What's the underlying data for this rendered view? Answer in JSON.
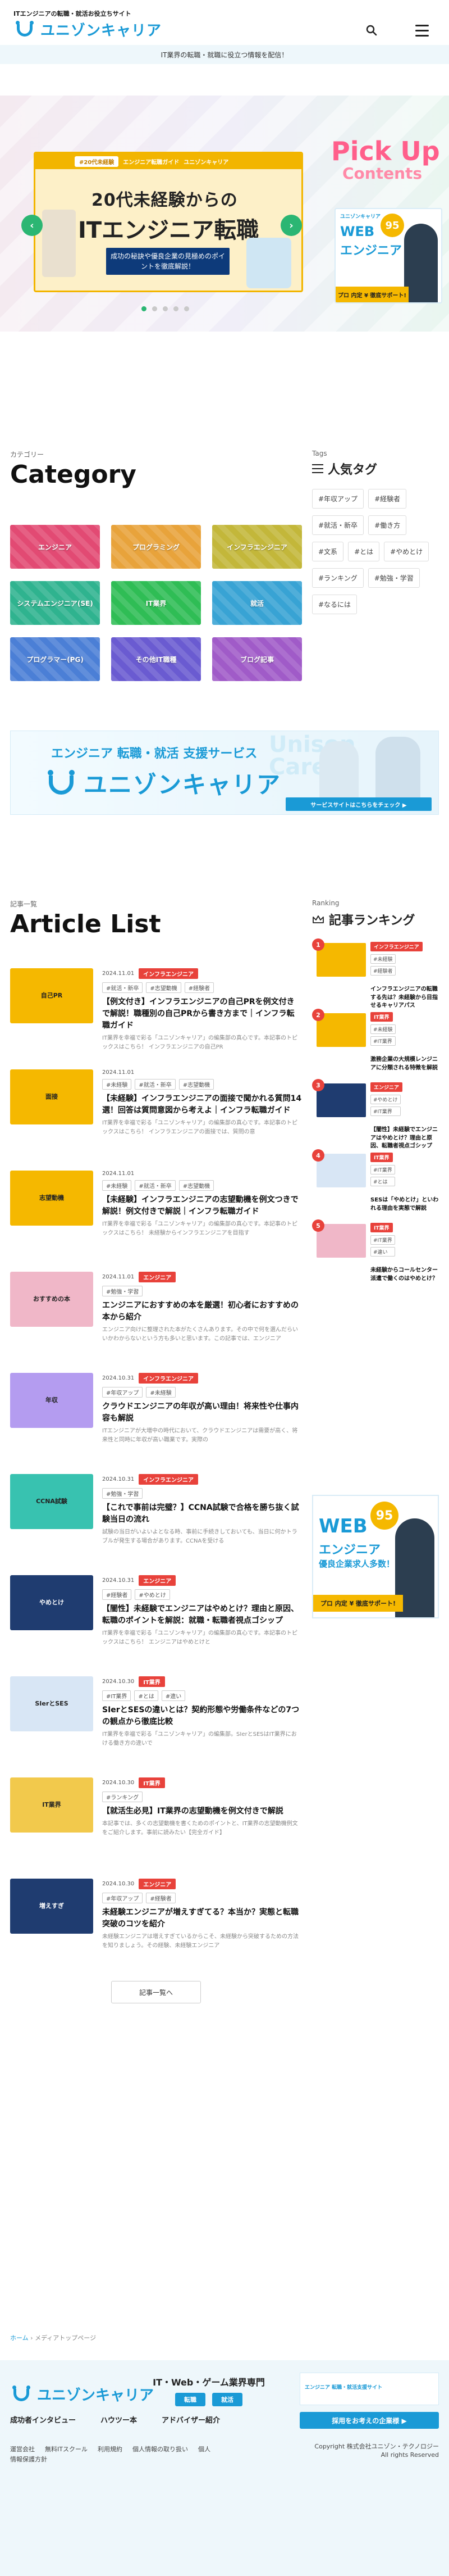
{
  "header": {
    "tagline": "ITエンジニアの転職・就活お役立ちサイト",
    "logo_text": "ユニゾンキャリア",
    "sub_message": "IT業界の転職・就職に役立つ情報を配信！"
  },
  "hero": {
    "slide": {
      "pill": "#20代未経験",
      "pill2": "エンジニア転職ガイド",
      "brand": "ユニゾンキャリア",
      "title1": "20代未経験からの",
      "title2": "ITエンジニア転職",
      "sub": "成功の秘訣や優良企業の見極めのポイントを徹底解説！"
    },
    "prev": "‹",
    "next": "›",
    "pickup_title": "Pick Up",
    "pickup_sub": "Contents",
    "ad": {
      "brand": "ユニゾンキャリア",
      "line1": "WEB",
      "line2": "エンジニア",
      "badge": "95",
      "footer": "プロ 内定 ¥ 徹底サポート!"
    }
  },
  "category": {
    "label": "カテゴリー",
    "title": "Category",
    "items": [
      {
        "label": "エンジニア",
        "color": "#e24a73"
      },
      {
        "label": "プログラミング",
        "color": "#e8a33b"
      },
      {
        "label": "インフラエンジニア",
        "color": "#c3b73a"
      },
      {
        "label": "システムエンジニア(SE)",
        "color": "#2fb38f"
      },
      {
        "label": "IT業界",
        "color": "#2fbd55"
      },
      {
        "label": "就活",
        "color": "#38a3d4"
      },
      {
        "label": "プログラマー(PG)",
        "color": "#4b7fd6"
      },
      {
        "label": "その他IT職種",
        "color": "#6a5bd1"
      },
      {
        "label": "ブログ記事",
        "color": "#a05bc8"
      }
    ]
  },
  "tags": {
    "label": "Tags",
    "title": "人気タグ",
    "items": [
      "#年収アップ",
      "#経験者",
      "#就活・新卒",
      "#働き方",
      "#文系",
      "#とは",
      "#やめとけ",
      "#ランキング",
      "#勉強・学習",
      "#なるには"
    ]
  },
  "banner": {
    "sub": "エンジニア 転職・就活 支援サービス",
    "logo": "ユニゾンキャリア",
    "bg_text": "Unison Career",
    "button": "サービスサイトはこちらをチェック ▶"
  },
  "articles": {
    "label": "記事一覧",
    "title": "Article List",
    "more": "記事一覧へ",
    "items": [
      {
        "date": "2024.11.01",
        "cat": "インフラエンジニア",
        "tags": [
          "#就活・新卒",
          "#志望動機",
          "#経験者"
        ],
        "title": "【例文付き】インフラエンジニアの自己PRを例文付きで解説！職種別の自己PRから書き方まで｜インフラ転職ガイド",
        "desc": "IT業界を幸福で彩る「ユニゾンキャリア」の編集部の真心です。本記事のトピックスはこちら！ インフラエンジニアの自己PR",
        "thumb": "自己PR",
        "tcolor": "#f5b800"
      },
      {
        "date": "2024.11.01",
        "cat": "",
        "tags": [
          "#未経験",
          "#就活・新卒",
          "#志望動機"
        ],
        "title": "【未経験】インフラエンジニアの面接で聞かれる質問14選！回答は質問意図から考えよ｜インフラ転職ガイド",
        "desc": "IT業界を幸福で彩る「ユニゾンキャリア」の編集部の真心です。本記事のトピックスはこちら！ インフラエンジニアの面接では、質問の意",
        "thumb": "面接",
        "tcolor": "#f5b800"
      },
      {
        "date": "2024.11.01",
        "cat": "",
        "tags": [
          "#未経験",
          "#就活・新卒",
          "#志望動機"
        ],
        "title": "【未経験】インフラエンジニアの志望動機を例文つきで解説！例文付きで解説｜インフラ転職ガイド",
        "desc": "IT業界を幸福で彩る「ユニゾンキャリア」の編集部の真心です。本記事のトピックスはこちら！ 未経験からインフラエンジニアを目指す",
        "thumb": "志望動機",
        "tcolor": "#f5b800"
      },
      {
        "date": "2024.11.01",
        "cat": "エンジニア",
        "tags": [
          "#勉強・学習"
        ],
        "title": "エンジニアにおすすめの本を厳選！初心者におすすめの本から紹介",
        "desc": "エンジニア向けに整理された本がたくさんあります。その中で何を選んだらいいかわからないという方も多いと思います。この記事では、エンジニア",
        "thumb": "おすすめの本",
        "tcolor": "#f0b7c8"
      },
      {
        "date": "2024.10.31",
        "cat": "インフラエンジニア",
        "tags": [
          "#年収アップ",
          "#未経験"
        ],
        "title": "クラウドエンジニアの年収が高い理由！将来性や仕事内容も解説",
        "desc": "ITエンジニアが大増中の時代において、クラウドエンジニアは需要が高く、将来性と同時に年収が高い職業です。実際の",
        "thumb": "年収",
        "tcolor": "#b49cf0"
      },
      {
        "date": "2024.10.31",
        "cat": "インフラエンジニア",
        "tags": [
          "#勉強・学習"
        ],
        "title": "【これで事前は完璧？】CCNA試験で合格を勝ち抜く試験当日の流れ",
        "desc": "試験の当日がいよいよとなる時、事前に手続きしておいても、当日に何かトラブルが発生する場合があります。CCNAを受ける",
        "thumb": "CCNA試験",
        "tcolor": "#38c2b0"
      },
      {
        "date": "2024.10.31",
        "cat": "エンジニア",
        "tags": [
          "#経験者",
          "#やめとけ"
        ],
        "title": "【闇性】未経験でエンジニアはやめとけ？理由と原因、転職のポイントを解説：就職・転職者視点ゴシップ",
        "desc": "IT業界を幸福で彩る「ユニゾンキャリア」の編集部の真心です。本記事のトピックスはこちら！ エンジニアはやめとけと",
        "thumb": "やめとけ",
        "tcolor": "#1f3c70"
      },
      {
        "date": "2024.10.30",
        "cat": "IT業界",
        "tags": [
          "#IT業界",
          "#とは",
          "#違い"
        ],
        "title": "SIerとSESの違いとは？契約形態や労働条件などの7つの観点から徹底比較",
        "desc": "IT業界を幸福で彩る「ユニゾンキャリア」の編集部。SIerとSESはIT業界における働き方の違いで",
        "thumb": "SIerとSES",
        "tcolor": "#d8e6f5"
      },
      {
        "date": "2024.10.30",
        "cat": "IT業界",
        "tags": [
          "#ランキング"
        ],
        "title": "【就活生必見】IT業界の志望動機を例文付きで解説",
        "desc": "本記事では、多くの志望動機を書くためのポイントと、IT業界の志望動機例文をご紹介します。事前に読みたい【完全ガイド】",
        "thumb": "IT業界",
        "tcolor": "#f2c94c"
      },
      {
        "date": "2024.10.30",
        "cat": "エンジニア",
        "tags": [
          "#年収アップ",
          "#経験者"
        ],
        "title": "未経験エンジニアが増えすぎてる？本当か？実態と転職突破のコツを紹介",
        "desc": "未経験エンジニアは増えすぎているからこそ、未経験から突破するための方法を知りましょう。その経験、未経験エンジニア",
        "thumb": "増えすぎ",
        "tcolor": "#1f3c70"
      }
    ]
  },
  "ranking": {
    "label": "Ranking",
    "title": "記事ランキング",
    "items": [
      {
        "rank": "1",
        "cat": "インフラエンジニア",
        "tags": [
          "#未経験",
          "#経験者"
        ],
        "title": "インフラエンジニアの転職する先は？未経験から目指せるキャリアパス"
      },
      {
        "rank": "2",
        "cat": "IT業界",
        "tags": [
          "#未経験",
          "#IT業界"
        ],
        "title": "激務企業の大規模レンジニアに分類される特徴を解説"
      },
      {
        "rank": "3",
        "cat": "エンジニア",
        "tags": [
          "#やめとけ",
          "#IT業界"
        ],
        "title": "【闇性】未経験でエンジニアはやめとけ？理由と原因、転職者視点ゴシップ"
      },
      {
        "rank": "4",
        "cat": "IT業界",
        "tags": [
          "#IT業界",
          "#とは"
        ],
        "title": "SESは「やめとけ」といわれる理由を実態で解説"
      },
      {
        "rank": "5",
        "cat": "IT業界",
        "tags": [
          "#IT業界",
          "#違い"
        ],
        "title": "未経験からコールセンター派遣で働くのはやめとけ？"
      }
    ]
  },
  "ad_big": {
    "badge": "95",
    "line1": "WEB",
    "line2": "エンジニア",
    "line3": "優良企業求人多数！",
    "footer": "プロ 内定 ¥ 徹底サポート!"
  },
  "breadcrumb": {
    "home": "ホーム",
    "current": "メディアトップページ"
  },
  "footer": {
    "logo": "ユニゾンキャリア",
    "center_head": "IT・Web・ゲーム業界専門",
    "btn1": "転職",
    "btn2": "就活",
    "ad": "エンジニア 転職・就活支援サイト",
    "cta": "採用をお考えの企業様 ▶",
    "links": [
      "成功者インタビュー",
      "ハウツー本",
      "アドバイザー紹介"
    ],
    "legal": [
      "運営会社",
      "無料ITスクール",
      "利用規約",
      "個人情報の取り扱い",
      "個人情報保護方針"
    ],
    "copy1": "Copyright 株式会社ユニゾン・テクノロジー",
    "copy2": "All rights Reserved"
  }
}
